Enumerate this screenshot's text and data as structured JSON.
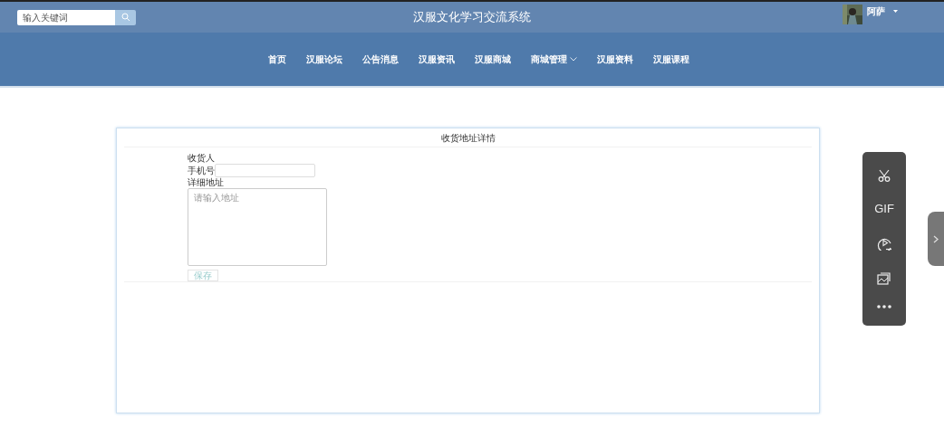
{
  "header": {
    "search": {
      "placeholder": "输入关键词"
    },
    "title": "汉服文化学习交流系统",
    "user": {
      "name": "阿萨"
    }
  },
  "nav": [
    {
      "label": "首页",
      "dropdown": false
    },
    {
      "label": "汉服论坛",
      "dropdown": false
    },
    {
      "label": "公告消息",
      "dropdown": false
    },
    {
      "label": "汉服资讯",
      "dropdown": false
    },
    {
      "label": "汉服商城",
      "dropdown": false
    },
    {
      "label": "商城管理",
      "dropdown": true
    },
    {
      "label": "汉服资料",
      "dropdown": false
    },
    {
      "label": "汉服课程",
      "dropdown": false
    }
  ],
  "form": {
    "title": "收货地址详情",
    "fields": [
      {
        "kind": "label",
        "label": "收货人"
      },
      {
        "kind": "input",
        "label": "手机号"
      },
      {
        "kind": "textarea",
        "label": "详细地址",
        "placeholder": "请输入地址"
      }
    ],
    "save_button": "保存"
  },
  "capture_toolbar": {
    "gif_label": "GIF"
  }
}
